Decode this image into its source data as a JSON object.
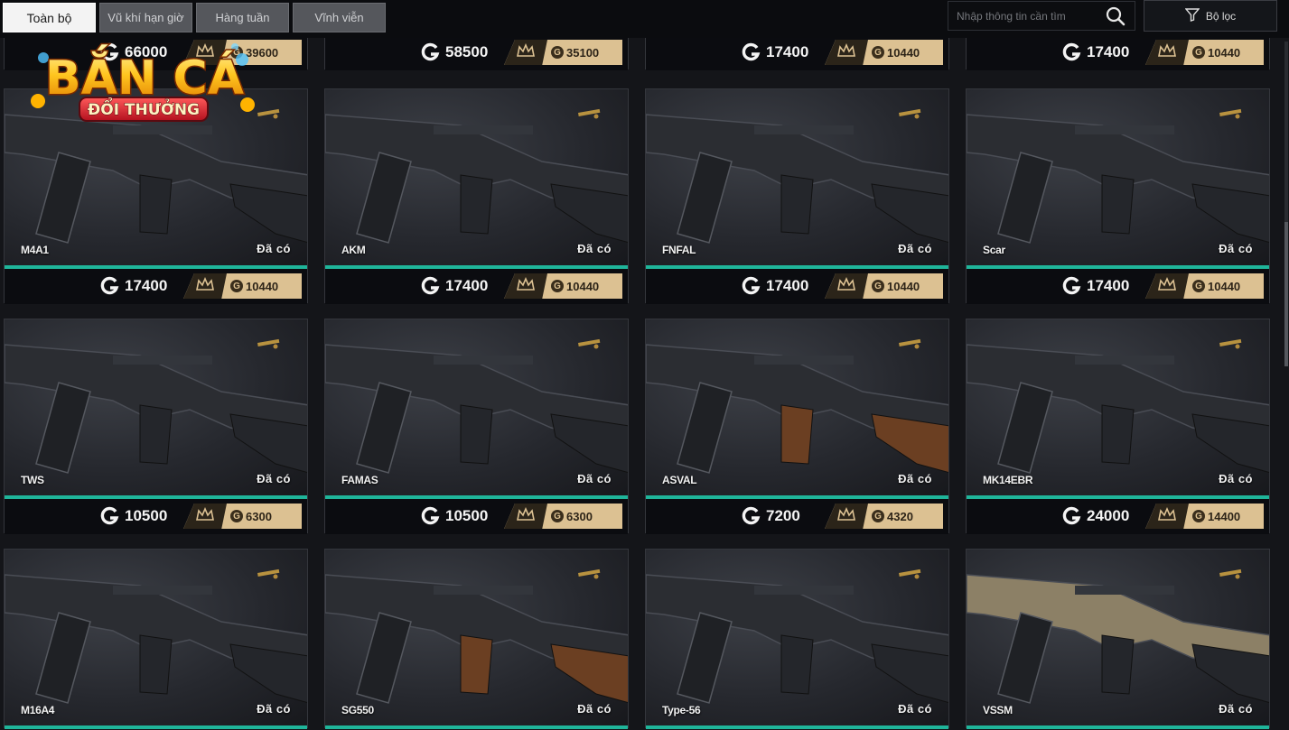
{
  "tabs": [
    {
      "label": "Toàn bộ"
    },
    {
      "label": "Vũ khí hạn giờ"
    },
    {
      "label": "Hàng tuần"
    },
    {
      "label": "Vĩnh viễn"
    }
  ],
  "search": {
    "placeholder": "Nhập thông tin cần tìm"
  },
  "filter": {
    "label": "Bộ lọc"
  },
  "logo": {
    "line1": "BẮN CÁ",
    "line2": "ĐỔI THƯỞNG"
  },
  "owned_label": "Đã có",
  "colors": {
    "accent_teal": "#1fb59a",
    "vip_gold": "#dcc192",
    "card_bg": "#1c1e23"
  },
  "rows": [
    {
      "items": [
        {
          "name": "",
          "price": "66000",
          "vip_price": "39600"
        },
        {
          "name": "",
          "price": "58500",
          "vip_price": "35100"
        },
        {
          "name": "",
          "price": "17400",
          "vip_price": "10440"
        },
        {
          "name": "",
          "price": "17400",
          "vip_price": "10440"
        }
      ]
    },
    {
      "items": [
        {
          "name": "M4A1",
          "price": "17400",
          "vip_price": "10440"
        },
        {
          "name": "AKM",
          "price": "17400",
          "vip_price": "10440"
        },
        {
          "name": "FNFAL",
          "price": "17400",
          "vip_price": "10440"
        },
        {
          "name": "Scar",
          "price": "17400",
          "vip_price": "10440"
        }
      ]
    },
    {
      "items": [
        {
          "name": "TWS",
          "price": "10500",
          "vip_price": "6300"
        },
        {
          "name": "FAMAS",
          "price": "10500",
          "vip_price": "6300"
        },
        {
          "name": "ASVAL",
          "price": "7200",
          "vip_price": "4320"
        },
        {
          "name": "MK14EBR",
          "price": "24000",
          "vip_price": "14400"
        }
      ]
    },
    {
      "items": [
        {
          "name": "M16A4"
        },
        {
          "name": "SG550"
        },
        {
          "name": "Type-56"
        },
        {
          "name": "VSSM"
        }
      ]
    }
  ]
}
